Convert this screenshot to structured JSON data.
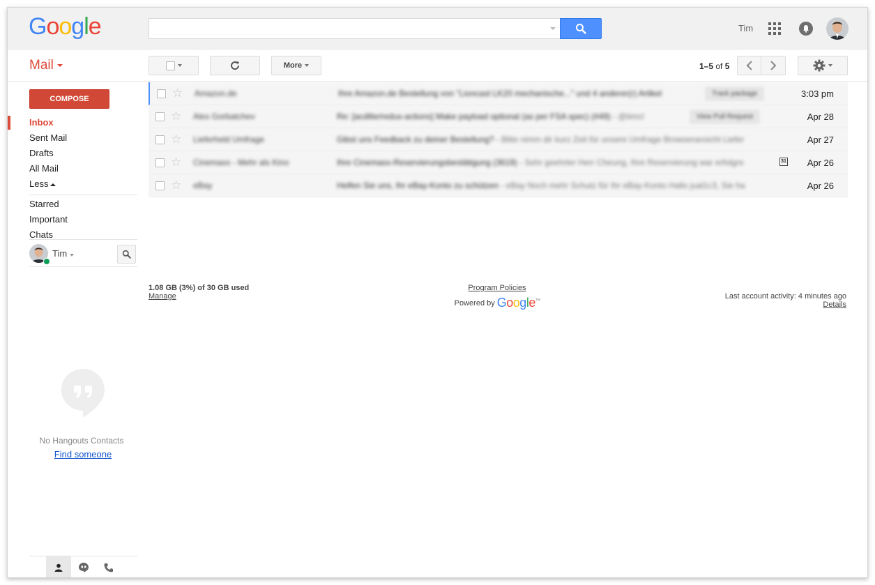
{
  "header": {
    "logo_letters": [
      {
        "ch": "G",
        "color": "#4285f4"
      },
      {
        "ch": "o",
        "color": "#ea4335"
      },
      {
        "ch": "o",
        "color": "#fbbc05"
      },
      {
        "ch": "g",
        "color": "#4285f4"
      },
      {
        "ch": "l",
        "color": "#34a853"
      },
      {
        "ch": "e",
        "color": "#ea4335"
      }
    ],
    "search_value": "",
    "user_name": "Tim"
  },
  "toolbar": {
    "app_label": "Mail",
    "more_label": "More",
    "page_start_end": "1–5",
    "page_of": "of",
    "page_total": "5"
  },
  "sidebar": {
    "compose_label": "COMPOSE",
    "items": [
      {
        "label": "Inbox",
        "active": true
      },
      {
        "label": "Sent Mail"
      },
      {
        "label": "Drafts"
      },
      {
        "label": "All Mail"
      },
      {
        "label": "Less"
      }
    ],
    "items2": [
      {
        "label": "Starred"
      },
      {
        "label": "Important"
      },
      {
        "label": "Chats"
      }
    ],
    "chat_user": "Tim",
    "no_contacts": "No Hangouts Contacts",
    "find_someone": "Find someone"
  },
  "mail": {
    "rows": [
      {
        "sender": "Amazon.de",
        "subject": "Ihre Amazon.de Bestellung von \"Lioncast LK20 mechanische...\" und 4 anderer(r) Artikel",
        "snippet": "",
        "chip": "Track package",
        "date": "3:03 pm",
        "selected": true
      },
      {
        "sender": "Alex Gorbatchev",
        "subject": "Re: [acdlite/redux-actions] Make payload optional (as per FSA spec) (#49)",
        "snippet": " - @timcl",
        "chip": "View Pull Request",
        "date": "Apr 28"
      },
      {
        "sender": "Lieferheld Umfrage",
        "subject": "Gibst uns Feedback zu deiner Bestellung?",
        "snippet": " - Bitte nimm dir kurz Zeit für unsere Umfrage Browseransicht Liefer",
        "date": "Apr 27"
      },
      {
        "sender": "Cinemaxx - Mehr als Kino",
        "subject": "Ihre Cinemaxx-Reservierungsbestätigung (3619)",
        "snippet": " - Sehr geehrter Herr Cheung, Ihre Reservierung war erfolgre",
        "calendar": "31",
        "date": "Apr 26"
      },
      {
        "sender": "eBay",
        "subject": "Helfen Sie uns, Ihr eBay-Konto zu schützen",
        "snippet": " - eBay Noch mehr Schutz für Ihr eBay-Konto Hallo jual1c3, Sie ha",
        "date": "Apr 26"
      }
    ]
  },
  "footer": {
    "storage": "1.08 GB (3%) of 30 GB used",
    "manage": "Manage",
    "program_policies": "Program Policies",
    "powered_by": "Powered by",
    "powered_logo": [
      {
        "ch": "G",
        "color": "#4285f4"
      },
      {
        "ch": "o",
        "color": "#ea4335"
      },
      {
        "ch": "o",
        "color": "#fbbc05"
      },
      {
        "ch": "g",
        "color": "#4285f4"
      },
      {
        "ch": "l",
        "color": "#34a853"
      },
      {
        "ch": "e",
        "color": "#ea4335"
      }
    ],
    "tm": "™",
    "last_activity": "Last account activity: 4 minutes ago",
    "details": "Details"
  },
  "colors": {
    "accent_red": "#dd4b39",
    "compose_red": "#d14836",
    "search_blue": "#4d90fe"
  }
}
